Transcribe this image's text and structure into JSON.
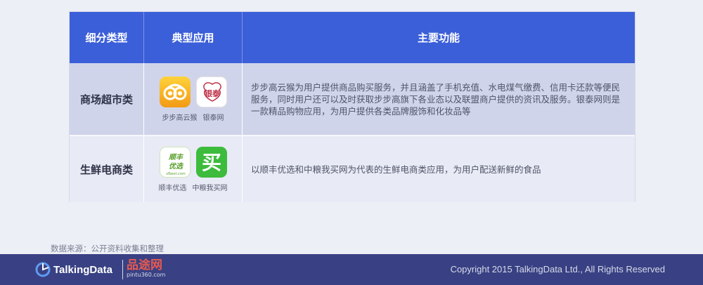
{
  "table": {
    "headers": [
      "细分类型",
      "典型应用",
      "主要功能"
    ],
    "rows": [
      {
        "category": "商场超市类",
        "apps": [
          "步步高云猴",
          "银泰网"
        ],
        "description": "步步高云猴为用户提供商品购买服务，并且涵盖了手机充值、水电煤气缴费、信用卡还款等便民服务，同时用户还可以及时获取步步高旗下各业态以及联盟商户提供的资讯及服务。银泰网则是一款精品购物应用，为用户提供各类品牌服饰和化妆品等"
      },
      {
        "category": "生鲜电商类",
        "apps": [
          "顺丰优选",
          "中粮我买网"
        ],
        "description": "以顺丰优选和中粮我买网为代表的生鲜电商类应用，为用户配送新鲜的食品"
      }
    ]
  },
  "icons": {
    "yintai_text": "银泰",
    "shunfeng_text": "顺丰优选",
    "shunfeng_domain": "sfbest.com",
    "zhongliang_text": "买"
  },
  "source": "数据来源：公开资料收集和整理",
  "footer": {
    "td_logo": "TalkingData",
    "pintu_main": "品途网",
    "pintu_sub": "pintu360.com",
    "copyright": "Copyright 2015 TalkingData Ltd., All Rights Reserved"
  },
  "colors": {
    "header_bg": "#3b5fd8",
    "footer_bg": "#394184",
    "row1_bg": "#d0d4ea",
    "row2_bg": "#e8eaf5"
  }
}
